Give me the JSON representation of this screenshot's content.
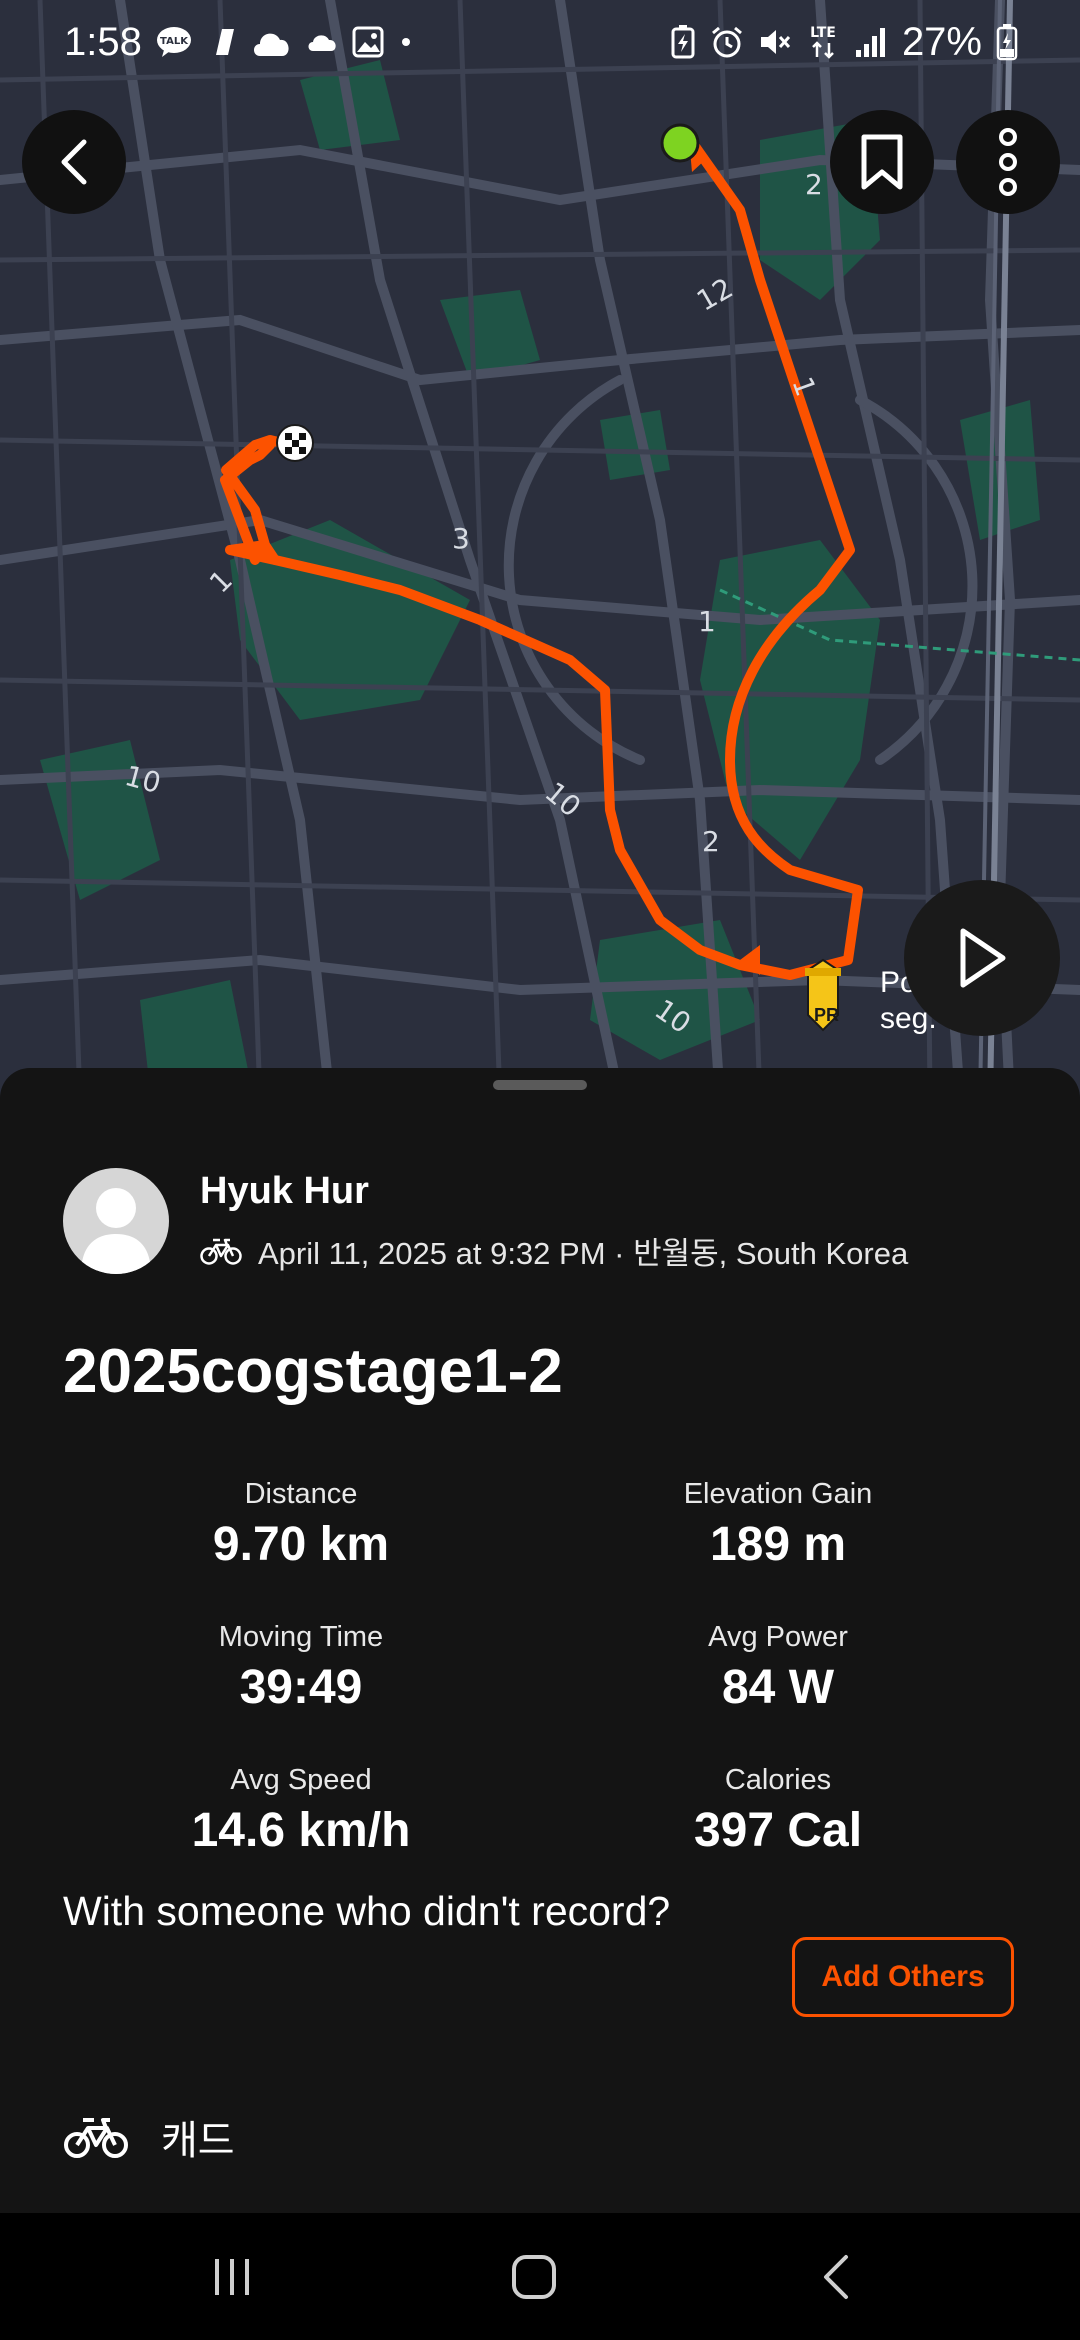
{
  "status_bar": {
    "time": "1:58",
    "battery": "27%",
    "network": "LTE",
    "left_icons": [
      "talk-icon",
      "flash-icon",
      "cloud-icon",
      "cloud-small-icon",
      "image-icon",
      "dot-icon"
    ],
    "right_icons": [
      "battery-saver-icon",
      "alarm-icon",
      "mute-icon",
      "lte-icon",
      "signal-icon",
      "battery-icon"
    ]
  },
  "map": {
    "road_labels": [
      "2",
      "12",
      "1",
      "3",
      "1",
      "1",
      "10",
      "10",
      "2",
      "10"
    ],
    "segment_label_line1": "Po",
    "segment_label_line2": "seg.",
    "pr_badge": "PR",
    "colors": {
      "route": "#fc5200",
      "start": "#7ed321",
      "park": "#1f5446",
      "road": "#4a5061",
      "background": "#2b2f3d"
    }
  },
  "header_buttons": {
    "back": "back-icon",
    "bookmark": "bookmark-icon",
    "more": "more-icon",
    "play": "play-icon"
  },
  "activity": {
    "athlete": "Hyuk Hur",
    "meta": "April 11, 2025 at 9:32 PM · 반월동, South Korea",
    "title": "2025cogstage1-2",
    "stats": [
      {
        "label": "Distance",
        "value": "9.70 km"
      },
      {
        "label": "Elevation Gain",
        "value": "189 m"
      },
      {
        "label": "Moving Time",
        "value": "39:49"
      },
      {
        "label": "Avg Power",
        "value": "84 W"
      },
      {
        "label": "Avg Speed",
        "value": "14.6 km/h"
      },
      {
        "label": "Calories",
        "value": "397 Cal"
      }
    ],
    "with_others_text": "With someone who didn't record?",
    "add_others_label": "Add Others",
    "gear": "캐드",
    "accent_color": "#fc5200"
  }
}
